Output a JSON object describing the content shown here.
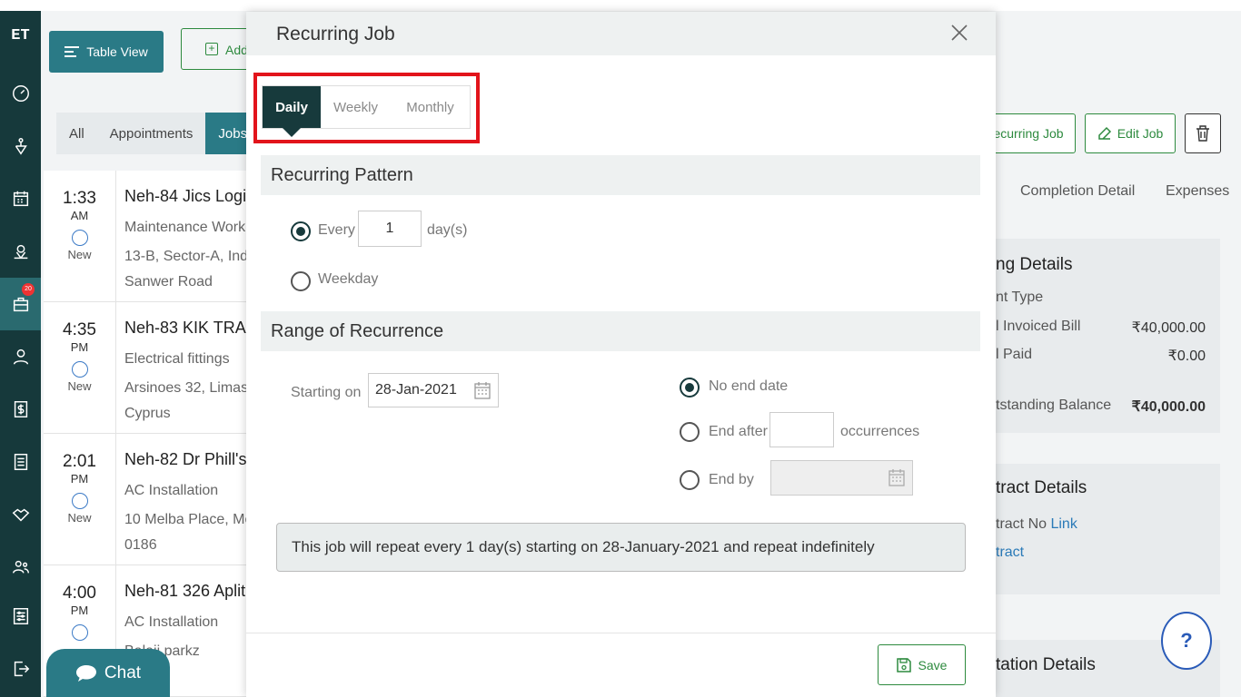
{
  "app": {
    "logo": "ET",
    "nav_badge": "20"
  },
  "toolbar": {
    "table_view": "Table View",
    "add": "Add"
  },
  "filter_tabs": [
    "All",
    "Appointments",
    "Jobs"
  ],
  "jobs": [
    {
      "time": "1:33",
      "ampm": "AM",
      "status": "New",
      "title": "Neh-84 Jics Logi",
      "type": "Maintenance Work",
      "addr1": "13-B, Sector-A, Ind",
      "addr2": "Sanwer Road"
    },
    {
      "time": "4:35",
      "ampm": "PM",
      "status": "New",
      "title": "Neh-83 KIK TRA",
      "type": "Electrical fittings",
      "addr1": "Arsinoes 32, Limass",
      "addr2": "Cyprus"
    },
    {
      "time": "2:01",
      "ampm": "PM",
      "status": "New",
      "title": "Neh-82 Dr Phill's",
      "type": "AC Installation",
      "addr1": "10 Melba Place, Mc",
      "addr2": "0186"
    },
    {
      "time": "4:00",
      "ampm": "PM",
      "status": "",
      "title": "Neh-81 326 Aplit",
      "type": "AC Installation",
      "addr1": "Balaji parkz",
      "addr2": ""
    }
  ],
  "right_panel": {
    "recurring_btn": "ecurring Job",
    "edit_btn": "Edit Job",
    "tabs": [
      "Completion Detail",
      "Expenses"
    ],
    "billing": {
      "title": "ng Details",
      "payment_type": "nt Type",
      "rows": [
        {
          "label": "l Invoiced Bill",
          "value": "₹40,000.00"
        },
        {
          "label": "l Paid",
          "value": "₹0.00"
        },
        {
          "label": "tstanding Balance",
          "value": "₹40,000.00"
        }
      ]
    },
    "contract": {
      "title": "tract Details",
      "no_label": "tract No",
      "link": "Link",
      "link2": "tract"
    },
    "quotation": {
      "title": "tation Details"
    }
  },
  "help": "?",
  "chat": "Chat",
  "modal": {
    "title": "Recurring Job",
    "freq_tabs": [
      "Daily",
      "Weekly",
      "Monthly"
    ],
    "pattern": {
      "heading": "Recurring Pattern",
      "every_label": "Every",
      "every_value": "1",
      "every_unit": "day(s)",
      "weekday_label": "Weekday"
    },
    "range": {
      "heading": "Range of Recurrence",
      "starting_label": "Starting on",
      "starting_value": "28-Jan-2021",
      "no_end": "No end date",
      "end_after": "End after",
      "end_after_unit": "occurrences",
      "end_by": "End by"
    },
    "summary": "This job will repeat every 1 day(s) starting on 28-January-2021 and repeat indefinitely",
    "save": "Save"
  },
  "colors": {
    "nav_bg": "#16393b",
    "accent": "#2a7a86",
    "green": "#2d8a3e",
    "highlight": "#e2141b"
  }
}
